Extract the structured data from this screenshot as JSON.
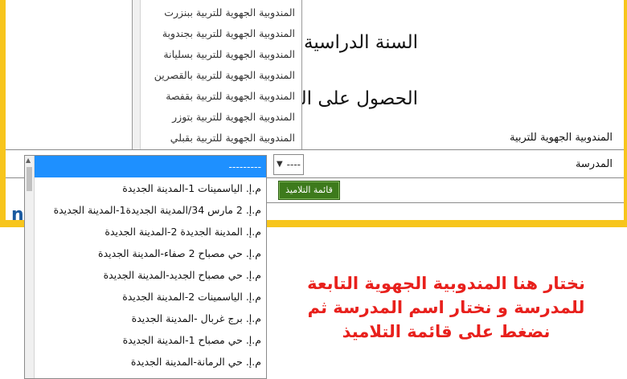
{
  "region_list": {
    "options": [
      "المندوبية الجهوية للتربية ببنزرت",
      "المندوبية الجهوية للتربية بجندوبة",
      "المندوبية الجهوية للتربية بسليانة",
      "المندوبية الجهوية للتربية بالقصرين",
      "المندوبية الجهوية للتربية بقفصة",
      "المندوبية الجهوية للتربية بتوزر",
      "المندوبية الجهوية للتربية بقبلي"
    ]
  },
  "form": {
    "school_year_heading": "السنة الدراسية",
    "identifier_heading": "الحصول على المعرف",
    "region_label": "المندوبية الجهوية للتربية",
    "school_label": "المدرسة",
    "school_select_value": "----",
    "students_button": "قائمة التلاميذ",
    "cut_letter": "n"
  },
  "school_dropdown": {
    "options": [
      "---------",
      "م.إ. الياسمينات 1-المدينة الجديدة",
      "م.إ. 2 مارس 34/المدينة الجديدة1-المدينة الجديدة",
      "م.إ. المدينة الجديدة 2-المدينة الجديدة",
      "م.إ. حي مصباح 2 صفاء-المدينة الجديدة",
      "م.إ. حي مصباح الجديد-المدينة الجديدة",
      "م.إ. الياسمينات 2-المدينة الجديدة",
      "م.إ. برج غربال -المدينة الجديدة",
      "م.إ. حي مصباح 1-المدينة الجديدة",
      "م.إ. حي الرمانة-المدينة الجديدة"
    ],
    "selected_index": 0
  },
  "annotation": {
    "line1": "نختار هنا المندوبية الجهوية التابعة",
    "line2": "للمدرسة و نختار اسم المدرسة ثم",
    "line3": "نضغط على قائمة التلاميذ"
  },
  "colors": {
    "frame": "#f7c51c",
    "button": "#3d7a1c",
    "selected": "#1e90ff",
    "annotation": "#e8201c"
  }
}
